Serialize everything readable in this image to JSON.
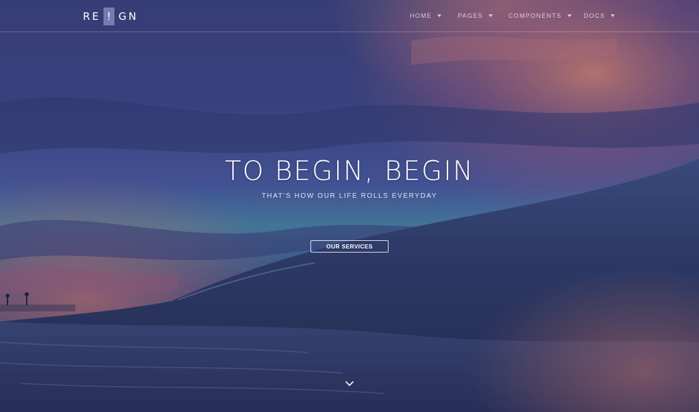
{
  "brand": {
    "prefix": "RE",
    "mark": "!",
    "suffix": "GN"
  },
  "nav": {
    "items": [
      {
        "label": "HOME"
      },
      {
        "label": "PAGES"
      },
      {
        "label": "COMPONENTS"
      },
      {
        "label": "DOCS"
      }
    ]
  },
  "hero": {
    "headline": "TO BEGIN, BEGIN",
    "subheadline": "THAT'S HOW OUR LIFE ROLLS EVERYDAY",
    "cta_label": "OUR SERVICES",
    "scroll_icon": "chevron-down-icon"
  },
  "colors": {
    "overlay": "#2b3566",
    "sky_accent": "#e07a6a",
    "teal": "#4aa6b0",
    "text": "#ffffff"
  }
}
